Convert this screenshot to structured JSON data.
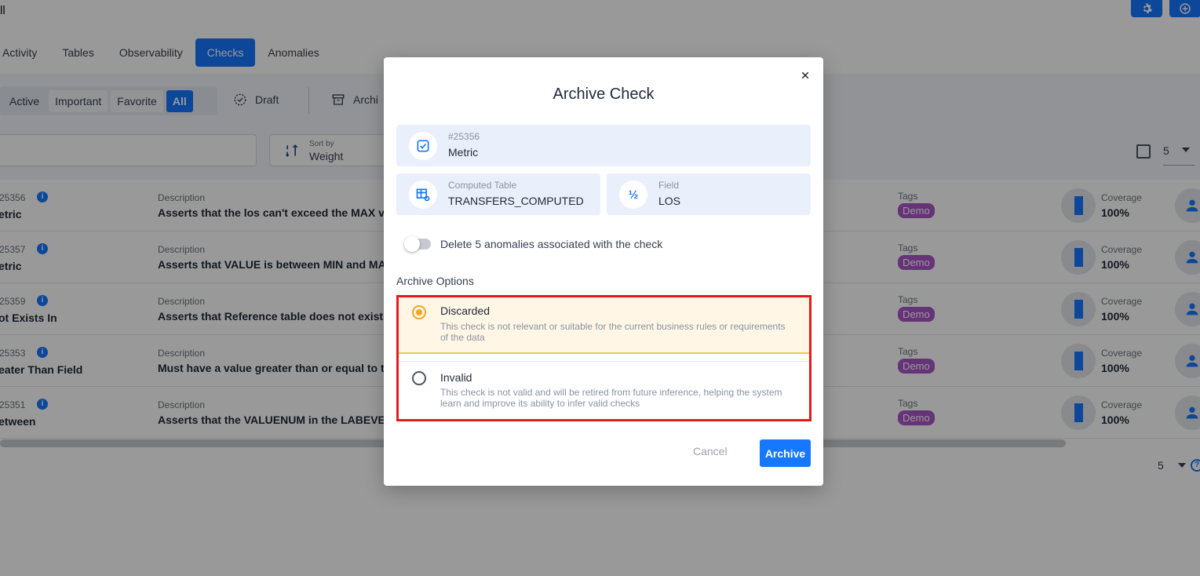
{
  "page": {
    "title": "ll",
    "tabs": [
      "Activity",
      "Tables",
      "Observability",
      "Checks",
      "Anomalies"
    ],
    "active_tab": "Checks",
    "segments": [
      "Active",
      "Important",
      "Favorite",
      "All"
    ],
    "active_segment": "All",
    "draft_label": "Draft",
    "archived_label": "Archi",
    "sort": {
      "label": "Sort by",
      "value": "Weight"
    },
    "page_size": "5",
    "rows": [
      {
        "id": "25356",
        "type": "etric",
        "desc_label": "Description",
        "desc": "Asserts that the los can't exceed the MAX value",
        "tags_label": "Tags",
        "tag": "Demo",
        "coverage_label": "Coverage",
        "coverage": "100%"
      },
      {
        "id": "25357",
        "type": "etric",
        "desc_label": "Description",
        "desc": "Asserts that VALUE is between MIN and MAX",
        "tags_label": "Tags",
        "tag": "Demo",
        "coverage_label": "Coverage",
        "coverage": "100%"
      },
      {
        "id": "25359",
        "type": "ot Exists In",
        "desc_label": "Description",
        "desc": "Asserts that Reference table does not exists",
        "tags_label": "Tags",
        "tag": "Demo",
        "coverage_label": "Coverage",
        "coverage": "100%"
      },
      {
        "id": "25353",
        "type": "eater Than Field",
        "desc_label": "Description",
        "desc": "Must have a value greater than or equal to the",
        "tags_label": "Tags",
        "tag": "Demo",
        "coverage_label": "Coverage",
        "coverage": "100%"
      },
      {
        "id": "25351",
        "type": "etween",
        "desc_label": "Description",
        "desc": "Asserts that the VALUENUM in the LABEVENTS",
        "tags_label": "Tags",
        "tag": "Demo",
        "coverage_label": "Coverage",
        "coverage": "100%"
      }
    ]
  },
  "modal": {
    "title": "Archive Check",
    "check": {
      "id": "#25356",
      "type": "Metric"
    },
    "table": {
      "label": "Computed Table",
      "value": "TRANSFERS_COMPUTED"
    },
    "field": {
      "label": "Field",
      "value": "LOS"
    },
    "field_icon_glyph": "½",
    "delete_toggle": {
      "label": "Delete 5 anomalies associated with the check",
      "on": false
    },
    "options_title": "Archive Options",
    "options": [
      {
        "title": "Discarded",
        "desc": "This check is not relevant or suitable for the current business rules or requirements of the data",
        "selected": true
      },
      {
        "title": "Invalid",
        "desc": "This check is not valid and will be retired from future inference, helping the system learn and improve its ability to infer valid checks",
        "selected": false
      }
    ],
    "cancel_label": "Cancel",
    "archive_label": "Archive"
  },
  "colors": {
    "accent": "#1677ff",
    "selected_option": "#f5a623",
    "highlight_frame": "#e31b1b",
    "tag": "#a855c7"
  },
  "icons": [
    "gear-icon",
    "add-icon",
    "draft-icon",
    "archive-icon",
    "sort-icon",
    "info-icon",
    "user-icon",
    "close-icon",
    "check-icon",
    "table-icon",
    "help-icon"
  ]
}
